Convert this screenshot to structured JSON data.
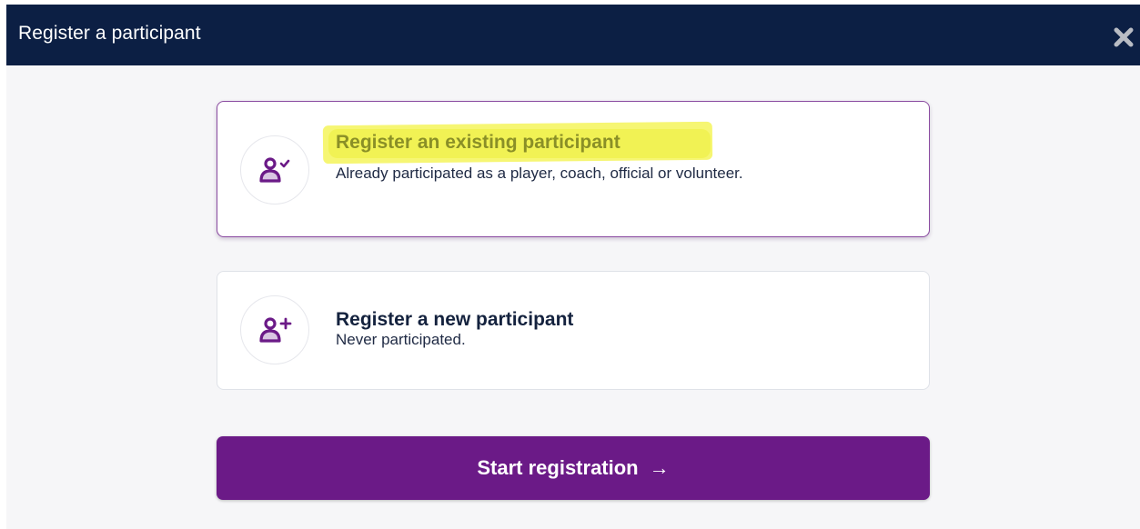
{
  "dialog": {
    "title": "Register a participant",
    "close_icon": "close-x-icon"
  },
  "options": [
    {
      "title": "Register an existing participant",
      "description": "Already participated as a player, coach, official or volunteer.",
      "icon": "user-check-icon",
      "selected": true,
      "highlighted": true
    },
    {
      "title": "Register a new participant",
      "description": "Never participated.",
      "icon": "user-plus-icon",
      "selected": false
    }
  ],
  "start_button": {
    "label": "Start registration",
    "arrow": "→",
    "icon": "arrow-right-icon"
  },
  "colors": {
    "header_bg": "#0c1f44",
    "accent_purple": "#6b1a87",
    "highlight": "#f5f55a"
  }
}
